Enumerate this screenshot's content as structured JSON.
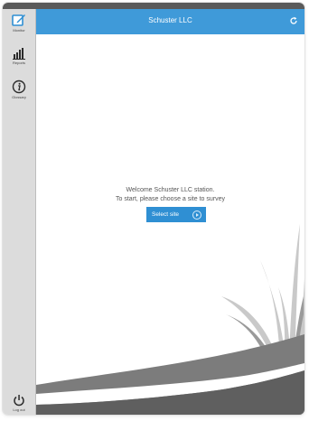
{
  "app": {
    "title": "Schuster LLC"
  },
  "sidebar": {
    "items": [
      {
        "label": "Monitor",
        "icon": "edit-icon"
      },
      {
        "label": "Reports",
        "icon": "bar-chart-icon"
      },
      {
        "label": "Glossary",
        "icon": "info-icon"
      }
    ],
    "logout": {
      "label": "Log out",
      "icon": "power-icon"
    }
  },
  "main": {
    "welcome_line1": "Welcome Schuster LLC station.",
    "welcome_line2": "To start, please choose a site to survey",
    "select_button": "Select site"
  },
  "colors": {
    "header": "#3f9ad9",
    "button": "#2f8fd3",
    "sidebar": "#dcdcdc"
  }
}
